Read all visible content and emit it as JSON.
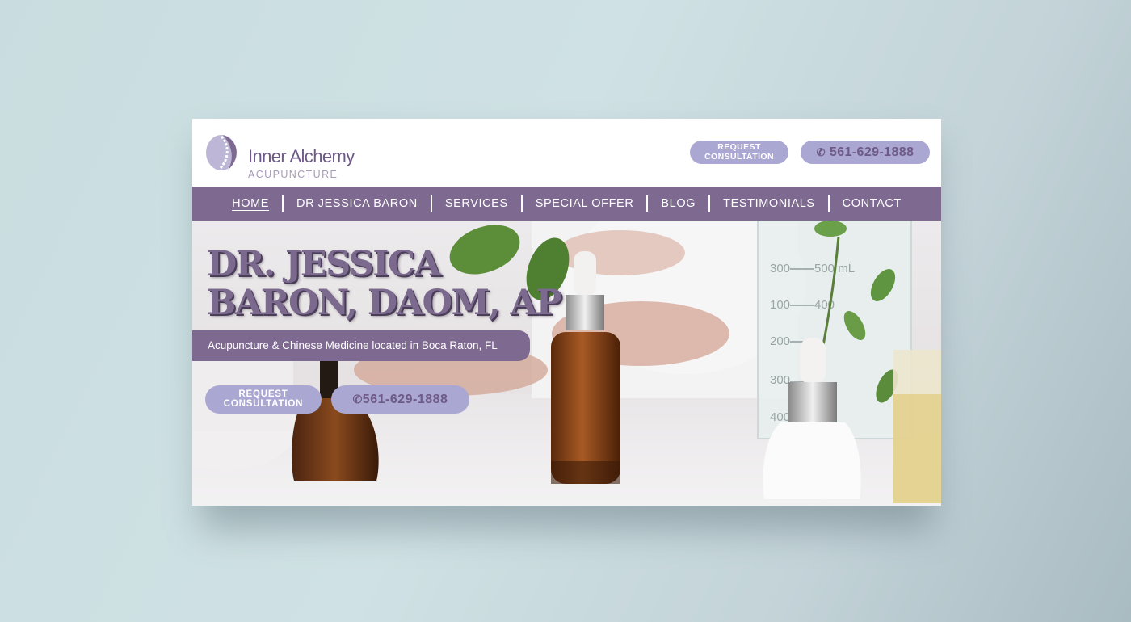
{
  "brand": {
    "name": "Inner Alchemy",
    "subtitle": "ACUPUNCTURE"
  },
  "header": {
    "request_label_1": "REQUEST",
    "request_label_2": "CONSULTATION",
    "phone": "561-629-1888",
    "phone_icon": "phone-icon"
  },
  "nav": {
    "items": [
      {
        "label": "HOME",
        "active": true
      },
      {
        "label": "DR JESSICA BARON"
      },
      {
        "label": "SERVICES"
      },
      {
        "label": "SPECIAL OFFER"
      },
      {
        "label": "BLOG"
      },
      {
        "label": "TESTIMONIALS"
      },
      {
        "label": "CONTACT"
      }
    ]
  },
  "hero": {
    "title_line1": "DR. JESSICA",
    "title_line2": "BARON, DAOM, AP",
    "tagline": "Acupuncture & Chinese Medicine located in Boca Raton, FL",
    "request_label_1": "REQUEST",
    "request_label_2": "CONSULTATION",
    "phone": "561-629-1888",
    "beaker_labels": [
      "500 mL",
      "400",
      "300",
      "100",
      "200",
      "300",
      "400"
    ]
  },
  "colors": {
    "brand_purple": "#7e6a90",
    "button_lavender": "#aaa7d2",
    "text_purple": "#6e5a86"
  }
}
